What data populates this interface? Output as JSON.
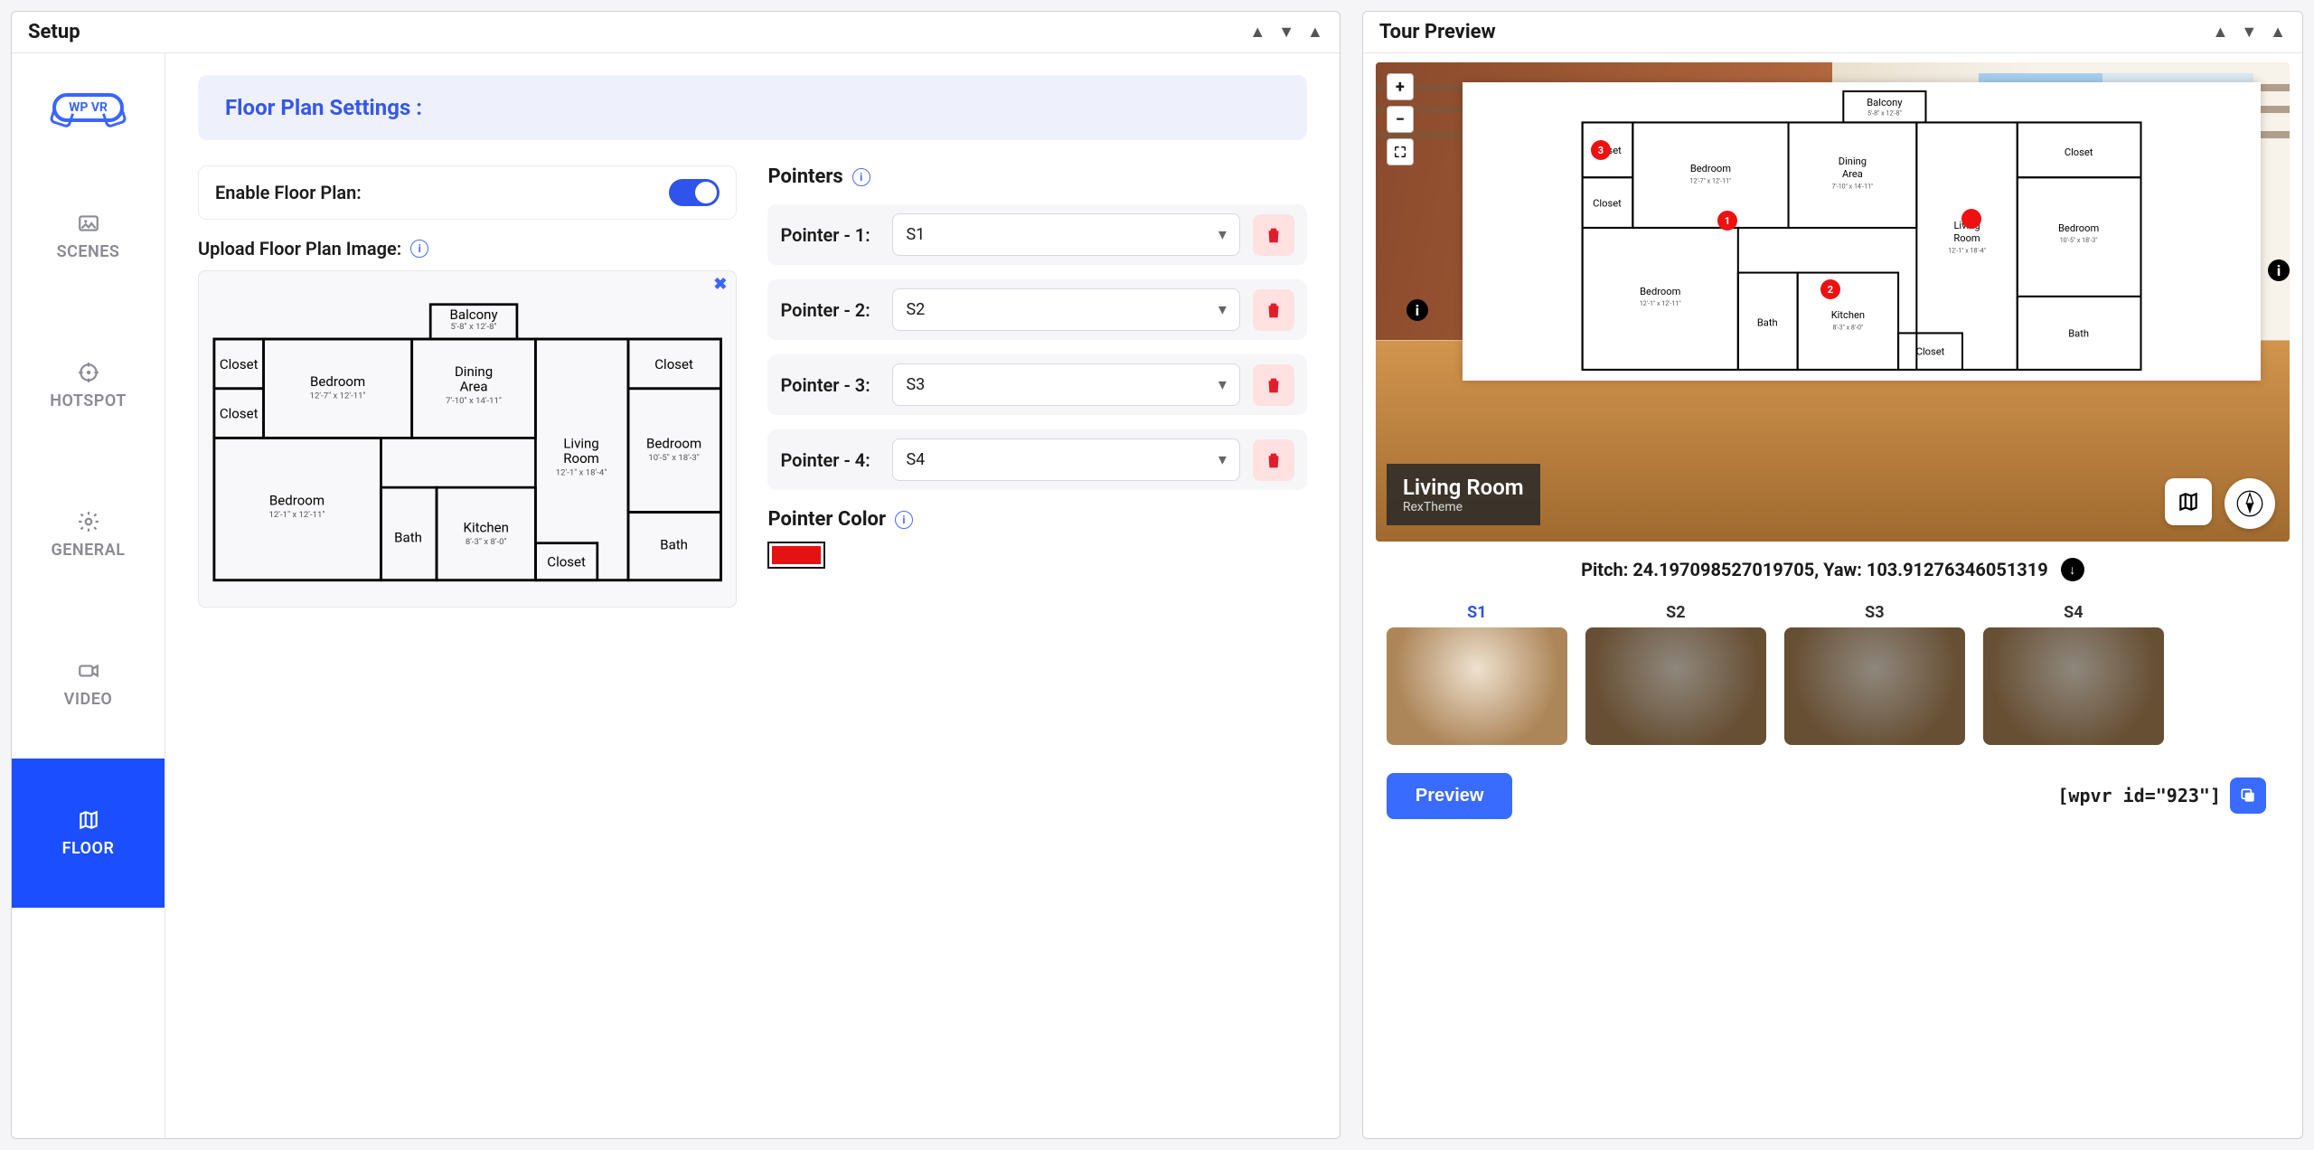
{
  "setup": {
    "title": "Setup",
    "section_title": "Floor Plan Settings :",
    "enable_label": "Enable Floor Plan:",
    "enable_value": true,
    "upload_label": "Upload Floor Plan Image:",
    "pointers_title": "Pointers",
    "pointer_color_title": "Pointer Color",
    "pointer_color": "#e41212",
    "pointers": [
      {
        "label": "Pointer - 1:",
        "value": "S1"
      },
      {
        "label": "Pointer - 2:",
        "value": "S2"
      },
      {
        "label": "Pointer - 3:",
        "value": "S3"
      },
      {
        "label": "Pointer - 4:",
        "value": "S4"
      }
    ]
  },
  "sidebar": {
    "logo": "WP VR",
    "items": [
      {
        "label": "SCENES"
      },
      {
        "label": "HOTSPOT"
      },
      {
        "label": "GENERAL"
      },
      {
        "label": "VIDEO"
      },
      {
        "label": "FLOOR"
      }
    ],
    "active_index": 4
  },
  "floorplan": {
    "rooms": [
      {
        "name": "Balcony",
        "dim": "5'-8\" x 12'-8\""
      },
      {
        "name": "Closet"
      },
      {
        "name": "Closet"
      },
      {
        "name": "Bedroom",
        "dim": "12'-7\" x 12'-11\""
      },
      {
        "name": "Dining Area",
        "dim": "7'-10\" x 14'-11\""
      },
      {
        "name": "Living Room",
        "dim": "12'-1\" x 18'-4\""
      },
      {
        "name": "Closet"
      },
      {
        "name": "Bedroom",
        "dim": "10'-5\" x 18'-3\""
      },
      {
        "name": "Bath"
      },
      {
        "name": "Bedroom",
        "dim": "12'-1\" x 12'-11\""
      },
      {
        "name": "Bath"
      },
      {
        "name": "Kitchen",
        "dim": "8'-3\" x 8'-0\""
      },
      {
        "name": "Closet"
      }
    ]
  },
  "preview": {
    "title": "Tour Preview",
    "scene_title": "Living Room",
    "scene_author": "RexTheme",
    "pitch_label": "Pitch:",
    "pitch_value": "24.197098527019705",
    "yaw_label": "Yaw:",
    "yaw_value": "103.91276346051319",
    "preview_btn": "Preview",
    "shortcode": "[wpvr id=\"923\"]",
    "scenes": [
      "S1",
      "S2",
      "S3",
      "S4"
    ],
    "active_scene": 0,
    "overlay_pointers": [
      "3",
      "1",
      "2"
    ]
  }
}
